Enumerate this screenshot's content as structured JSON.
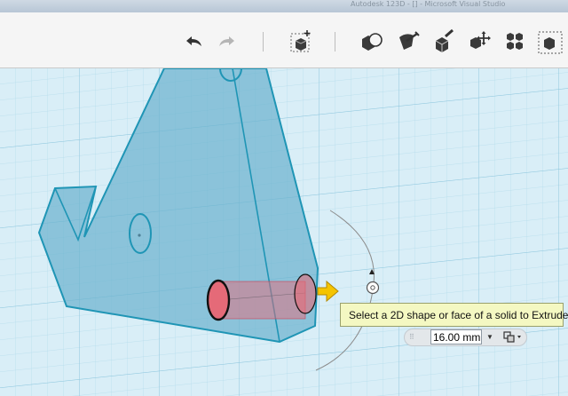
{
  "window": {
    "title": "Autodesk 123D - [] - Microsoft Visual Studio"
  },
  "toolbar": {
    "undo_icon": "undo-icon",
    "redo_icon": "redo-icon",
    "primitives_icon": "add-box-icon",
    "sketch_icon": "sketch-icon",
    "construct_icon": "construct-icon",
    "modify_icon": "modify-icon",
    "transform_icon": "transform-icon",
    "pattern_icon": "pattern-icon",
    "grouping_icon": "combine-icon"
  },
  "extrude": {
    "tooltip": "Select a 2D shape or face of a solid to Extrude",
    "distance_value": "16.00 mm",
    "dropdown_icon": "chevron-down-icon",
    "operation_icon": "merge-operation-icon",
    "arrow_color": "#f5c400",
    "face_color": "#e56a78"
  },
  "colors": {
    "grid_background": "#d9eef7",
    "grid_line": "#a9d6e8",
    "solid_fill": "#6cb3cf",
    "solid_edge": "#1f95b5"
  }
}
